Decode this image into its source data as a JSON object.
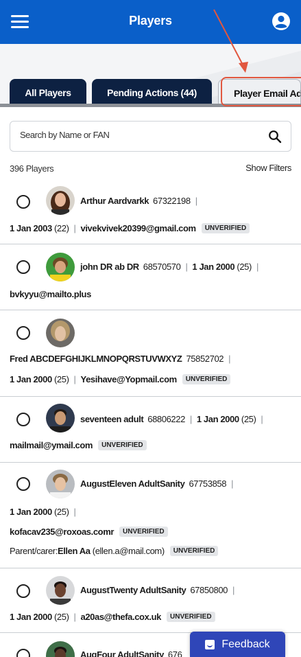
{
  "header": {
    "title": "Players"
  },
  "tabs": [
    {
      "label": "All Players"
    },
    {
      "label": "Pending Actions (44)"
    },
    {
      "label": "Player Email Add"
    }
  ],
  "search": {
    "placeholder": "Search by Name or FAN"
  },
  "list": {
    "count": "396 Players",
    "filters_label": "Show Filters"
  },
  "players": [
    {
      "name": "Arthur Aardvarkk",
      "fan": "67322198",
      "dob": "1 Jan 2003",
      "age": "(22)",
      "email": "vivekvivek20399@gmail.com",
      "status": "UNVERIFIED"
    },
    {
      "name": "john DR ab DR",
      "fan": "68570570",
      "dob": "1 Jan 2000",
      "age": "(25)",
      "email": "bvkyyu@mailto.plus"
    },
    {
      "name": "Fred ABCDEFGHIJKLMNOPQRSTUVWXYZ",
      "fan": "75852702",
      "dob": "1 Jan 2000",
      "age": "(25)",
      "email": "Yesihave@Yopmail.com",
      "status": "UNVERIFIED"
    },
    {
      "name": "seventeen adult",
      "fan": "68806222",
      "dob": "1 Jan 2000",
      "age": "(25)",
      "email": "mailmail@ymail.com",
      "status": "UNVERIFIED"
    },
    {
      "name": "AugustEleven AdultSanity",
      "fan": "67753858",
      "dob": "1 Jan 2000",
      "age": "(25)",
      "email": "kofacav235@roxoas.comr",
      "status": "UNVERIFIED",
      "parent_label": "Parent/carer:",
      "parent_name": "Ellen Aa",
      "parent_email": "(ellen.a@mail.com)",
      "parent_status": "UNVERIFIED"
    },
    {
      "name": "AugustTwenty AdultSanity",
      "fan": "67850800",
      "dob": "1 Jan 2000",
      "age": "(25)",
      "email": "a20as@thefa.cox.uk",
      "status": "UNVERIFIED"
    },
    {
      "name": "AugFour AdultSanity",
      "fan": "676"
    }
  ],
  "feedback": {
    "label": "Feedback"
  },
  "colors": {
    "brand_blue": "#0a5fc9",
    "tab_dark": "#0d2142",
    "callout": "#e1573f",
    "feedback": "#2f46b8"
  }
}
